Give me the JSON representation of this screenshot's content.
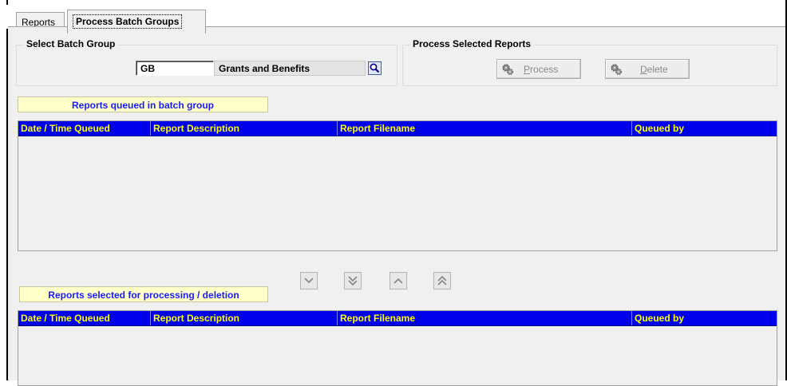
{
  "tabs": [
    {
      "label": "Reports",
      "active": false
    },
    {
      "label": "Process Batch Groups",
      "active": true
    }
  ],
  "select_batch_group": {
    "title": "Select Batch Group",
    "code_value": "GB",
    "description_value": "Grants and Benefits",
    "lookup_icon": "magnifier-icon"
  },
  "process_selected_reports": {
    "title": "Process Selected Reports",
    "process_label_prefix": "P",
    "process_label_rest": "rocess",
    "delete_label_prefix": "D",
    "delete_label_rest": "elete",
    "button_icon": "gears-icon"
  },
  "queued_section": {
    "label": "Reports queued in batch group",
    "columns": [
      "Date / Time Queued",
      "Report Description",
      "Report Filename",
      "Queued by"
    ],
    "rows": []
  },
  "move_buttons": [
    {
      "name": "move-down-button",
      "icon": "chevron-down-icon"
    },
    {
      "name": "move-all-down-button",
      "icon": "double-chevron-down-icon"
    },
    {
      "name": "move-up-button",
      "icon": "chevron-up-icon"
    },
    {
      "name": "move-all-up-button",
      "icon": "double-chevron-up-icon"
    }
  ],
  "selected_section": {
    "label": "Reports selected for processing / deletion",
    "columns": [
      "Date / Time Queued",
      "Report Description",
      "Report Filename",
      "Queued by"
    ],
    "rows": []
  },
  "colors": {
    "grid_header_bg": "#0000ee",
    "grid_header_text": "#ffff00",
    "label_box_bg": "#ffffc8",
    "label_box_text": "#1a1aff",
    "panel_bg": "#f0f0f0"
  }
}
